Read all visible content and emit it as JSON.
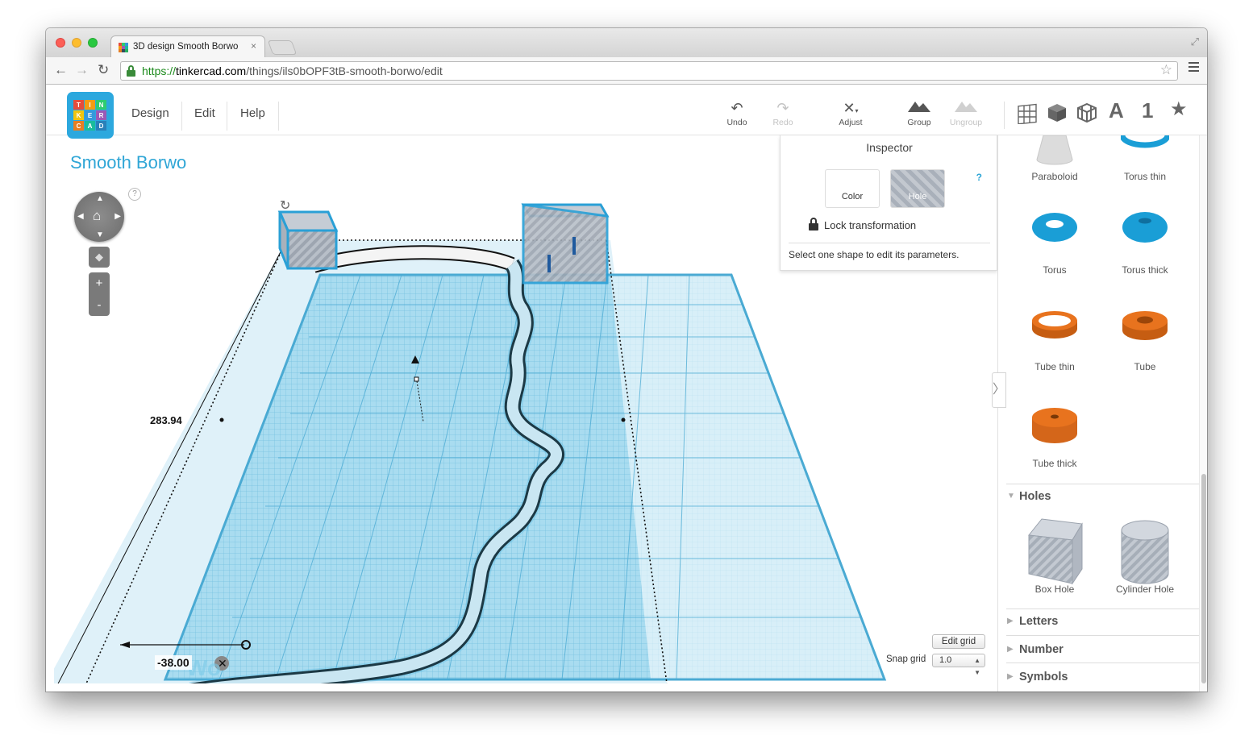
{
  "browser": {
    "tab_title": "3D design Smooth Borwo",
    "tab_close": "×",
    "url_scheme": "https://",
    "url_host": "tinkercad.com",
    "url_path": "/things/ils0bOPF3tB-smooth-borwo/edit",
    "back_icon": "back-arrow-icon",
    "forward_icon": "forward-arrow-icon",
    "reload_icon": "reload-icon",
    "bookmark_icon": "star-icon"
  },
  "app": {
    "logo_letters": [
      "T",
      "I",
      "N",
      "K",
      "E",
      "R",
      "C",
      "A",
      "D"
    ],
    "menu": [
      "Design",
      "Edit",
      "Help"
    ],
    "tools": {
      "undo": "Undo",
      "redo": "Redo",
      "adjust": "Adjust",
      "group": "Group",
      "ungroup": "Ungroup"
    },
    "view_icons": [
      "grid-view-icon",
      "cube-view-icon",
      "wireframe-view-icon",
      "text-icon",
      "number-icon",
      "favorites-star-icon"
    ],
    "view_labels": {
      "text": "A",
      "number": "1"
    }
  },
  "canvas": {
    "design_title": "Smooth Borwo",
    "help": "?",
    "zoom_in": "+",
    "zoom_out": "-",
    "dim_length": "283.94",
    "dim_offset": "-38.00"
  },
  "inspector": {
    "title": "Inspector",
    "color_label": "Color",
    "hole_label": "Hole",
    "help": "?",
    "lock_label": "Lock transformation",
    "message": "Select one shape to edit its parameters."
  },
  "grid": {
    "edit_button": "Edit grid",
    "snap_label": "Snap grid",
    "snap_value": "1.0"
  },
  "sidebar": {
    "shapes": [
      {
        "label": "Paraboloid",
        "kind": "paraboloid",
        "color": "#d9d9d9"
      },
      {
        "label": "Torus thin",
        "kind": "torus-thin",
        "color": "#1a9ed6"
      },
      {
        "label": "Torus",
        "kind": "torus",
        "color": "#1a9ed6"
      },
      {
        "label": "Torus thick",
        "kind": "torus-thick",
        "color": "#1a9ed6"
      },
      {
        "label": "Tube thin",
        "kind": "tube-thin",
        "color": "#e8731e"
      },
      {
        "label": "Tube",
        "kind": "tube",
        "color": "#e8731e"
      },
      {
        "label": "Tube thick",
        "kind": "tube-thick",
        "color": "#e8731e"
      }
    ],
    "categories": [
      {
        "label": "Holes",
        "expanded": true
      },
      {
        "label": "Letters",
        "expanded": false
      },
      {
        "label": "Number",
        "expanded": false
      },
      {
        "label": "Symbols",
        "expanded": false
      }
    ],
    "holes": [
      {
        "label": "Box Hole",
        "kind": "box-hole"
      },
      {
        "label": "Cylinder Hole",
        "kind": "cylinder-hole"
      }
    ]
  },
  "colors": {
    "accent": "#2fa6d6",
    "workplane": "#86cbe6",
    "orange": "#e8731e"
  }
}
